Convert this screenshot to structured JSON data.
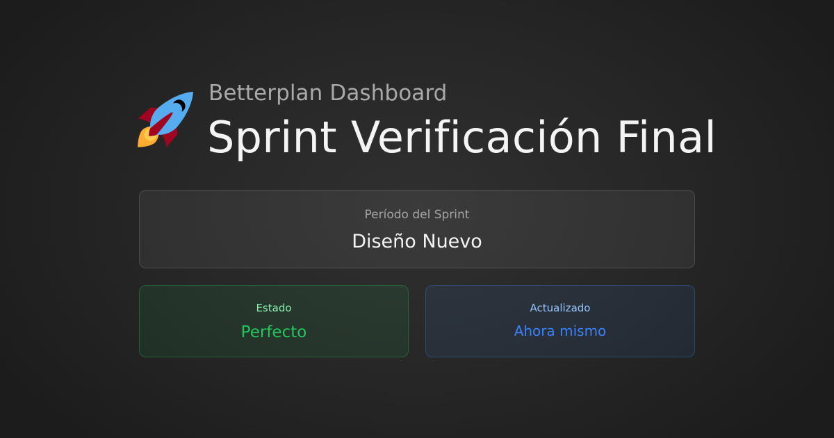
{
  "header": {
    "icon": "rocket-icon",
    "subtitle": "Betterplan Dashboard",
    "title": "Sprint Verificación Final"
  },
  "period_card": {
    "label": "Período del Sprint",
    "value": "Diseño Nuevo"
  },
  "status_card": {
    "label": "Estado",
    "value": "Perfecto",
    "accent": "#22c55e"
  },
  "updated_card": {
    "label": "Actualizado",
    "value": "Ahora mismo",
    "accent": "#3b82f6"
  }
}
